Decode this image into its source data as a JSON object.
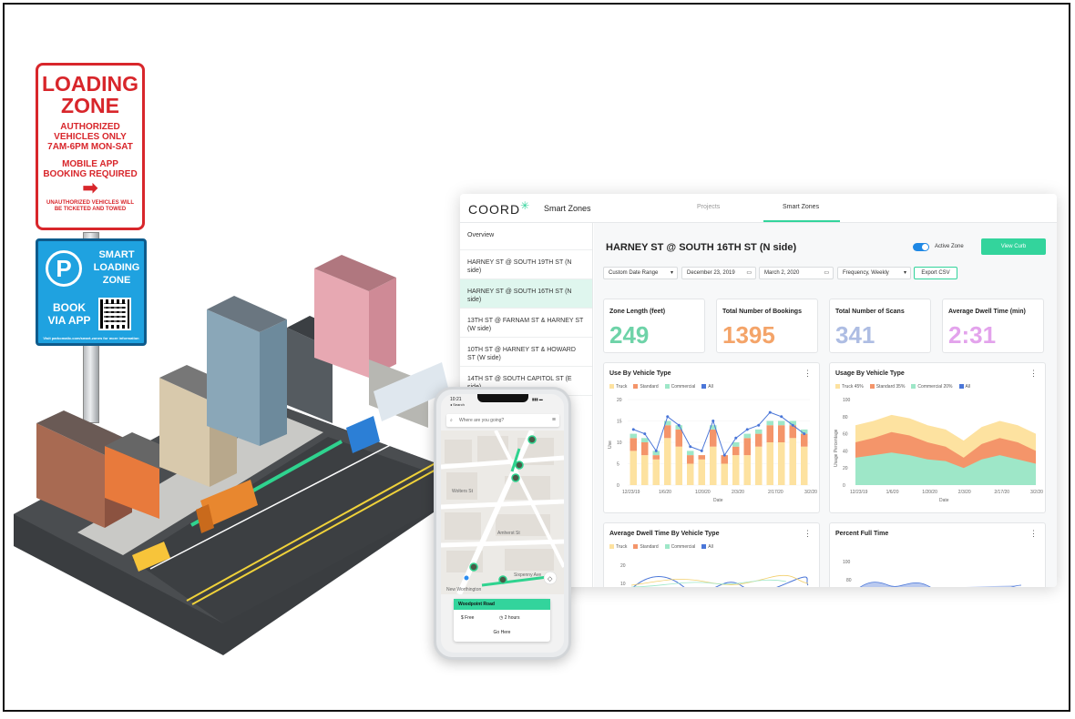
{
  "sign_red": {
    "line1": "LOADING",
    "line2": "ZONE",
    "line3": "AUTHORIZED",
    "line4": "VEHICLES ONLY",
    "line5": "7AM-6PM MON-SAT",
    "line6": "MOBILE APP",
    "line7": "BOOKING REQUIRED",
    "arrow": "➡",
    "line8": "UNAUTHORIZED VEHICLES WILL",
    "line9": "BE TICKETED AND TOWED"
  },
  "sign_blue": {
    "p": "P",
    "smart1": "SMART",
    "smart2": "LOADING",
    "smart3": "ZONE",
    "book1": "BOOK",
    "book2": "VIA APP",
    "footer": "Visit parkomatic.com/smart-zones for more information"
  },
  "dashboard": {
    "logo": "COORD",
    "logo_mark": "✳",
    "title": "Smart Zones",
    "tabs": [
      {
        "label": "Projects"
      },
      {
        "label": "Smart Zones"
      }
    ],
    "sidebar": [
      {
        "label": "Overview"
      },
      {
        "label": "HARNEY ST @ SOUTH 19TH ST (N side)"
      },
      {
        "label": "HARNEY ST @ SOUTH 16TH ST (N side)"
      },
      {
        "label": "13TH ST @ FARNAM ST & HARNEY ST (W side)"
      },
      {
        "label": "10TH ST @ HARNEY ST & HOWARD ST (W side)"
      },
      {
        "label": "14TH ST @ SOUTH CAPITOL ST (E side)"
      }
    ],
    "zone_title": "HARNEY ST @ SOUTH 16TH ST (N side)",
    "active_zone_label": "Active Zone",
    "view_curb_label": "View Curb",
    "filters": {
      "date_range": "Custom Date Range",
      "start_date": "December 23, 2019",
      "end_date": "March 2, 2020",
      "frequency": "Frequency,  Weekly",
      "export": "Export CSV",
      "dropdown_icon": "▾",
      "calendar_icon": "▭"
    },
    "kpis": [
      {
        "label": "Zone Length (feet)",
        "value": "249",
        "color": "#6ed3a8"
      },
      {
        "label": "Total Number of Bookings",
        "value": "1395",
        "color": "#f4a469"
      },
      {
        "label": "Total Number of Scans",
        "value": "341",
        "color": "#aebde3"
      },
      {
        "label": "Average Dwell Time (min)",
        "value": "2:31",
        "color": "#e3a3ec"
      }
    ],
    "menu_icon": "⋮",
    "legend_default": [
      {
        "label": "Truck",
        "color": "#fde2a0"
      },
      {
        "label": "Standard",
        "color": "#f4956a"
      },
      {
        "label": "Commercial",
        "color": "#9ee7c8"
      },
      {
        "label": "All",
        "color": "#4a76d8"
      }
    ],
    "legend_pct": [
      {
        "label": "Truck 45%",
        "color": "#fde2a0"
      },
      {
        "label": "Standard 35%",
        "color": "#f4956a"
      },
      {
        "label": "Commercial 20%",
        "color": "#9ee7c8"
      },
      {
        "label": "All",
        "color": "#4a76d8"
      }
    ],
    "cards": {
      "use_by_vehicle": "Use By Vehicle Type",
      "usage_by_vehicle": "Usage By Vehicle Type",
      "avg_dwell": "Average Dwell Time By Vehicle Type",
      "percent_full": "Percent Full Time"
    }
  },
  "chart_data": [
    {
      "type": "bar",
      "title": "Use By Vehicle Type",
      "xlabel": "Date",
      "ylabel": "Use",
      "ylim": [
        0,
        20
      ],
      "yticks": [
        "0",
        "5",
        "10",
        "15",
        "20"
      ],
      "xticks": [
        "12/23/19",
        "1/6/20",
        "1/20/20",
        "2/3/20",
        "2/17/20",
        "3/2/20"
      ],
      "categories": [
        "12/23/19",
        "",
        "",
        "1/6/20",
        "",
        "",
        "1/20/20",
        "",
        "",
        "2/3/20",
        "",
        "",
        "2/17/20",
        "",
        "",
        "3/2/20"
      ],
      "series": [
        {
          "name": "Truck",
          "values": [
            8,
            7,
            6,
            11,
            9,
            5,
            6,
            9,
            5,
            7,
            7,
            9,
            10,
            10,
            11,
            9
          ]
        },
        {
          "name": "Standard",
          "values": [
            3,
            3,
            1,
            3,
            4,
            2,
            1,
            4,
            2,
            2,
            4,
            3,
            4,
            4,
            3,
            3
          ]
        },
        {
          "name": "Commercial",
          "values": [
            1,
            1,
            1,
            1,
            1,
            1,
            0,
            1,
            0,
            1,
            1,
            1,
            1,
            1,
            1,
            1
          ]
        },
        {
          "name": "All",
          "values": [
            13,
            12,
            8,
            16,
            14,
            9,
            8,
            15,
            7,
            11,
            13,
            14,
            17,
            16,
            14,
            12
          ]
        }
      ]
    },
    {
      "type": "area",
      "title": "Usage By Vehicle Type",
      "xlabel": "Date",
      "ylabel": "Usage Percentage",
      "ylim": [
        0,
        100
      ],
      "yticks": [
        "0",
        "20",
        "40",
        "60",
        "80",
        "100"
      ],
      "xticks": [
        "12/23/19",
        "1/6/20",
        "1/20/20",
        "2/3/20",
        "2/17/20",
        "3/2/20"
      ],
      "x": [
        0,
        1,
        2,
        3,
        4,
        5,
        6,
        7,
        8,
        9,
        10
      ],
      "series": [
        {
          "name": "Commercial 20%",
          "values": [
            32,
            35,
            38,
            35,
            30,
            28,
            20,
            30,
            35,
            30,
            25
          ]
        },
        {
          "name": "Standard 35%",
          "values": [
            50,
            55,
            62,
            58,
            50,
            45,
            32,
            48,
            55,
            50,
            40
          ]
        },
        {
          "name": "Truck 45%",
          "values": [
            70,
            75,
            82,
            78,
            70,
            65,
            52,
            68,
            75,
            70,
            60
          ]
        }
      ]
    },
    {
      "type": "line",
      "title": "Average Dwell Time By Vehicle Type",
      "yticks": [
        "20",
        "10"
      ]
    },
    {
      "type": "area",
      "title": "Percent Full Time",
      "yticks": [
        "100",
        "80"
      ]
    }
  ],
  "phone": {
    "time": "10:21",
    "search_back": "◂ Search",
    "signal": "▮▮▮ ▬",
    "search_placeholder": "Where are you going?",
    "search_icon": "⌕",
    "menu_icon": "≡",
    "location_icon": "◇",
    "streets": [
      "Wolters St",
      "Amherst St",
      "Sixpenny Ave",
      "New Worthington"
    ],
    "card_title": "Woodpoint Road",
    "price_icon": "$",
    "price": "Free",
    "clock_icon": "◷",
    "duration": "2 hours",
    "go_here": "Go Here"
  }
}
